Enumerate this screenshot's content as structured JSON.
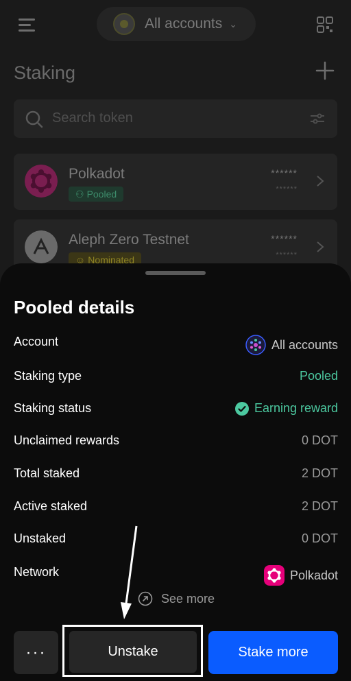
{
  "header": {
    "account_label": "All accounts",
    "page_title": "Staking",
    "search_placeholder": "Search token"
  },
  "tokens": [
    {
      "name": "Polkadot",
      "badge": "Pooled",
      "amount": "******",
      "sub_amount": "******"
    },
    {
      "name": "Aleph Zero Testnet",
      "badge": "Nominated",
      "amount": "******",
      "sub_amount": "******"
    }
  ],
  "sheet": {
    "title": "Pooled details",
    "rows": [
      {
        "label": "Account",
        "value": "All accounts"
      },
      {
        "label": "Staking type",
        "value": "Pooled"
      },
      {
        "label": "Staking status",
        "value": "Earning reward"
      },
      {
        "label": "Unclaimed rewards",
        "value": "0 DOT"
      },
      {
        "label": "Total staked",
        "value": "2 DOT"
      },
      {
        "label": "Active staked",
        "value": "2 DOT"
      },
      {
        "label": "Unstaked",
        "value": "0 DOT"
      },
      {
        "label": "Network",
        "value": "Polkadot"
      }
    ],
    "see_more": "See more"
  },
  "actions": {
    "more": "···",
    "unstake": "Unstake",
    "stake_more": "Stake more"
  },
  "colors": {
    "primary": "#0a5cff",
    "success": "#4cc9a0",
    "polkadot": "#e6007a"
  }
}
